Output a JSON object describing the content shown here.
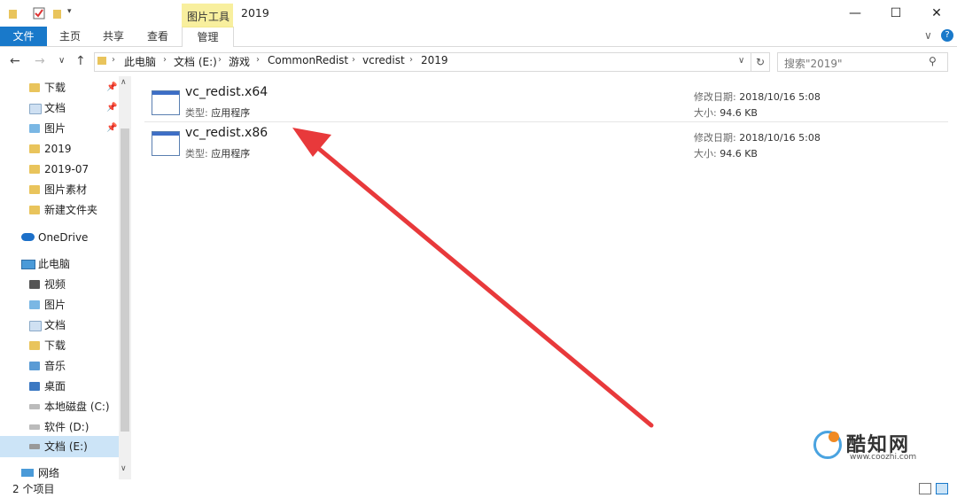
{
  "window": {
    "title": "2019",
    "context_tab": "图片工具",
    "controls": {
      "minimize": "—",
      "maximize": "☐",
      "close": "✕"
    }
  },
  "ribbon": {
    "tabs": [
      "文件",
      "主页",
      "共享",
      "查看",
      "管理"
    ],
    "collapse": "∨",
    "help": "?"
  },
  "address": {
    "crumbs": [
      "此电脑",
      "文档 (E:)",
      "游戏",
      "CommonRedist",
      "vcredist",
      "2019"
    ],
    "dropdown": "∨",
    "refresh": "↻",
    "search_placeholder": "搜索\"2019\""
  },
  "nav": {
    "quick_access": [
      {
        "label": "下载",
        "pinned": true,
        "icon": "download-icon"
      },
      {
        "label": "文档",
        "pinned": true,
        "icon": "document-icon"
      },
      {
        "label": "图片",
        "pinned": true,
        "icon": "picture-icon"
      },
      {
        "label": "2019",
        "pinned": false,
        "icon": "folder-icon"
      },
      {
        "label": "2019-07",
        "pinned": false,
        "icon": "folder-icon"
      },
      {
        "label": "图片素材",
        "pinned": false,
        "icon": "folder-icon"
      },
      {
        "label": "新建文件夹",
        "pinned": false,
        "icon": "folder-icon"
      }
    ],
    "onedrive": "OneDrive",
    "this_pc": "此电脑",
    "pc_items": [
      {
        "label": "视频",
        "icon": "video-icon"
      },
      {
        "label": "图片",
        "icon": "picture-icon"
      },
      {
        "label": "文档",
        "icon": "document-icon"
      },
      {
        "label": "下载",
        "icon": "download-icon"
      },
      {
        "label": "音乐",
        "icon": "music-icon"
      },
      {
        "label": "桌面",
        "icon": "desktop-icon"
      },
      {
        "label": "本地磁盘 (C:)",
        "icon": "drive-c-icon"
      },
      {
        "label": "软件 (D:)",
        "icon": "drive-icon"
      },
      {
        "label": "文档 (E:)",
        "icon": "drive-icon",
        "selected": true
      }
    ],
    "network": "网络"
  },
  "files": [
    {
      "name": "vc_redist.x64",
      "type_label": "类型:",
      "type": "应用程序",
      "date_label": "修改日期:",
      "date": "2018/10/16 5:08",
      "size_label": "大小:",
      "size": "94.6 KB"
    },
    {
      "name": "vc_redist.x86",
      "type_label": "类型:",
      "type": "应用程序",
      "date_label": "修改日期:",
      "date": "2018/10/16 5:08",
      "size_label": "大小:",
      "size": "94.6 KB"
    }
  ],
  "status": {
    "count": "2 个项目"
  },
  "watermark": {
    "name": "酷知网",
    "url": "www.coozhi.com"
  },
  "colors": {
    "accent": "#1979ca",
    "context_tab": "#f8ef9e",
    "annotation_arrow": "#e8393b"
  }
}
